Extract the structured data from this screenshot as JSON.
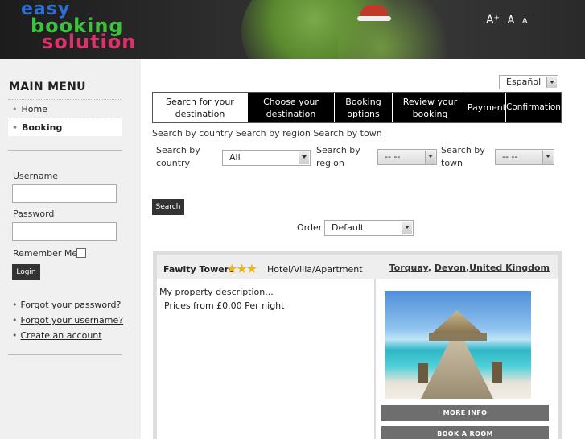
{
  "header": {
    "logo": {
      "line1": "easy",
      "line2": "booking",
      "line3": "solution"
    },
    "font_controls": {
      "increase": "A⁺",
      "normal": "A",
      "decrease": "A⁻"
    }
  },
  "sidebar": {
    "menu_title": "MAIN MENU",
    "menu_items": [
      {
        "label": "Home",
        "active": false
      },
      {
        "label": "Booking",
        "active": true
      }
    ],
    "login": {
      "username_label": "Username",
      "username_value": "",
      "password_label": "Password",
      "password_value": "",
      "remember_label": "Remember Me",
      "login_button": "Login"
    },
    "links": [
      {
        "label": "Forgot your password?"
      },
      {
        "label": "Forgot your username?"
      },
      {
        "label": "Create an account"
      }
    ]
  },
  "main": {
    "language": "Español",
    "steps": [
      {
        "line1": "Search for your",
        "line2": "destination",
        "current": true
      },
      {
        "line1": "Choose your",
        "line2": "destination",
        "current": false
      },
      {
        "line1": "Booking",
        "line2": "options",
        "current": false
      },
      {
        "line1": "Review your",
        "line2": "booking",
        "current": false
      },
      {
        "line1": "Payment",
        "line2": "",
        "current": false
      },
      {
        "line1": "Confirmation",
        "line2": "",
        "current": false
      }
    ],
    "search_tabs": "Search by country Search by region Search by town",
    "filters": {
      "country": {
        "label1": "Search by",
        "label2": "country",
        "value": "All"
      },
      "region": {
        "label1": "Search by",
        "label2": "region",
        "value": "-- --"
      },
      "town": {
        "label1": "Search by",
        "label2": "town",
        "value": "-- --"
      }
    },
    "search_button": "Search",
    "order": {
      "label": "Order",
      "value": "Default"
    },
    "result": {
      "name": "Fawlty Towers",
      "stars": 3,
      "type": "Hotel/Villa/Apartment",
      "location": {
        "town": "Torquay",
        "sep1": ", ",
        "region": "Devon",
        "sep2": ",",
        "country": "United Kingdom"
      },
      "description": "My property description...",
      "price": "Prices from £0.00 Per night",
      "more_info": "MORE INFO",
      "book": "BOOK A ROOM"
    }
  },
  "colors": {
    "brand_blue": "#2b6fd6",
    "brand_green": "#3cc23c",
    "brand_pink": "#e0306a",
    "star_gold": "#e8b620"
  }
}
